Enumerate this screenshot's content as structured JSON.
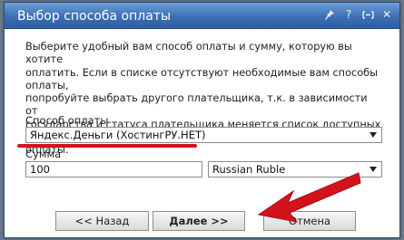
{
  "dialog": {
    "title": "Выбор способа оплаты",
    "title_buttons": [
      {
        "icon": "pin-icon"
      },
      {
        "icon": "help-icon",
        "label": "?"
      },
      {
        "icon": "restore-icon"
      },
      {
        "icon": "close-icon",
        "label": "✕"
      }
    ]
  },
  "description": "Выберите удобный вам способ оплаты и сумму, которую вы хотите\nоплатить. Если в списке отсутствуют необходимые вам способы оплаты,\nпопробуйте выбрать другого плательщика, т.к. в зависимости от\nгосударства и статуса плательщика меняется список доступных методов\nоплаты.",
  "payment_method": {
    "label": "Способ оплаты",
    "selected": "Яндекс.Деньги (ХостингРУ.НЕТ)"
  },
  "amount": {
    "label": "Сумма",
    "value": "100"
  },
  "currency": {
    "selected": "Russian Ruble"
  },
  "buttons": {
    "back": "<< Назад",
    "next": "Далее >>",
    "cancel": "Отмена"
  },
  "annotations": {
    "highlight_color": "#d3131b"
  }
}
